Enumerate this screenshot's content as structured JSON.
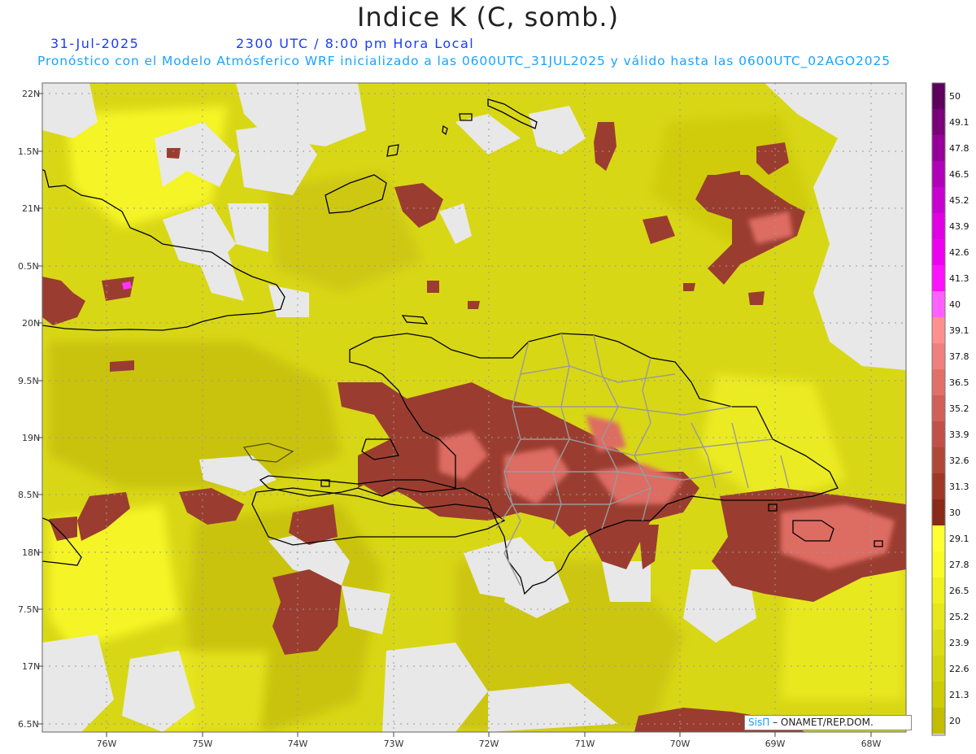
{
  "title": "Indice K (C, somb.)",
  "header": {
    "date": "31-Jul-2025",
    "time": "2300 UTC / 8:00 pm Hora Local",
    "forecast": "Pronóstico con el Modelo Atmósferico WRF inicializado a las 0600UTC_31JUL2025 y válido hasta las  0600UTC_02AGO2025"
  },
  "map": {
    "lat_labels": [
      "22N",
      "1.5N",
      "21N",
      "0.5N",
      "20N",
      "9.5N",
      "19N",
      "8.5N",
      "18N",
      "7.5N",
      "17N",
      "6.5N"
    ],
    "lon_labels": [
      "76W",
      "75W",
      "74W",
      "73W",
      "72W",
      "71W",
      "70W",
      "69W",
      "68W"
    ],
    "grid": true,
    "colors": {
      "land_missing": "#e8e8e8",
      "k_20": "#c8c000",
      "k_25": "#e6e61a",
      "k_29": "#ffff33",
      "k_31": "#9c4032",
      "k_35": "#e07068",
      "k_40": "#ff00ff",
      "coastline": "#000000",
      "provinces": "#999999"
    }
  },
  "colorbar": {
    "labels": [
      "50",
      "49.1",
      "47.8",
      "46.5",
      "45.2",
      "43.9",
      "42.6",
      "41.3",
      "40",
      "39.1",
      "37.8",
      "36.5",
      "35.2",
      "33.9",
      "32.6",
      "31.3",
      "30",
      "29.1",
      "27.8",
      "26.5",
      "25.2",
      "23.9",
      "22.6",
      "21.3",
      "20"
    ],
    "colors": [
      "#5c005c",
      "#7a007a",
      "#96009a",
      "#b000b8",
      "#c800d0",
      "#e000e4",
      "#f000f0",
      "#ff10ff",
      "#ff60ff",
      "#ff9090",
      "#f08080",
      "#e07068",
      "#d06058",
      "#c05048",
      "#b04838",
      "#a03828",
      "#8a2a18",
      "#ffff33",
      "#fafa28",
      "#f0f01e",
      "#e6e61a",
      "#dcdc14",
      "#d4d40c",
      "#cccc06",
      "#c4bc00"
    ]
  },
  "credit": {
    "sis": "SisΠ",
    "org": "– ONAMET/REP.DOM."
  }
}
